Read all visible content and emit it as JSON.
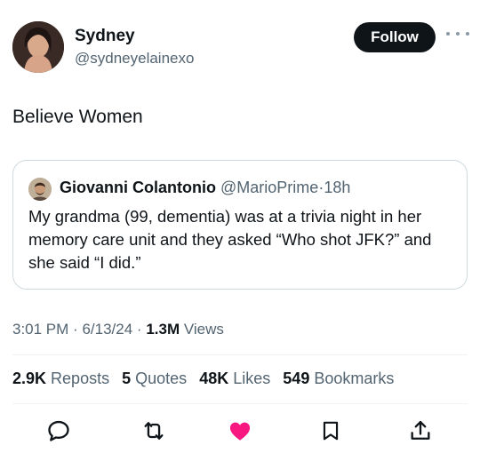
{
  "author": {
    "name": "Sydney",
    "handle": "@sydneyelainexo"
  },
  "follow_label": "Follow",
  "tweet_text": "Believe Women",
  "quote": {
    "name": "Giovanni Colantonio",
    "handle": "@MarioPrime",
    "separator": "·",
    "time": "18h",
    "text": "My grandma (99, dementia) was at a trivia night in her memory care unit and they asked “Who shot JFK?” and she said “I did.”"
  },
  "meta": {
    "time": "3:01 PM",
    "date": "6/13/24",
    "separator": "·",
    "views_count": "1.3M",
    "views_label": "Views"
  },
  "stats": {
    "reposts_count": "2.9K",
    "reposts_label": "Reposts",
    "quotes_count": "5",
    "quotes_label": "Quotes",
    "likes_count": "48K",
    "likes_label": "Likes",
    "bookmarks_count": "549",
    "bookmarks_label": "Bookmarks"
  },
  "icons": {
    "more": "more-horizontal-icon",
    "reply": "reply-icon",
    "retweet": "retweet-icon",
    "like": "heart-filled-icon",
    "bookmark": "bookmark-icon",
    "share": "share-icon"
  },
  "colors": {
    "text": "#0f1419",
    "secondary": "#536471",
    "like": "#f91880",
    "follow_bg": "#0f1419",
    "border": "#cfd9de"
  }
}
